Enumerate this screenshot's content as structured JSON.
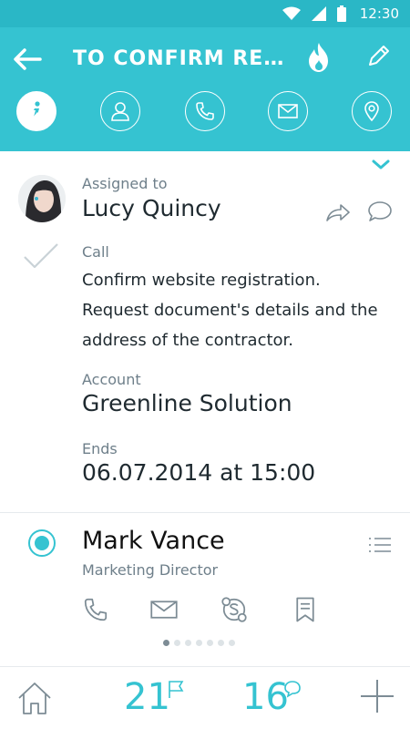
{
  "status": {
    "time": "12:30",
    "icons": [
      "wifi-icon",
      "signal-icon",
      "battery-icon"
    ]
  },
  "header": {
    "title": "TO CONFIRM REGIST...",
    "back_icon": "arrow-left-icon",
    "priority_icon": "fire-icon",
    "edit_icon": "pencil-icon",
    "tabs": [
      {
        "icon": "info-icon",
        "active": true
      },
      {
        "icon": "user-icon",
        "active": false
      },
      {
        "icon": "phone-icon",
        "active": false
      },
      {
        "icon": "mail-icon",
        "active": false
      },
      {
        "icon": "location-icon",
        "active": false
      }
    ]
  },
  "task": {
    "assigned_label": "Assigned to",
    "assigned_name": "Lucy Quincy",
    "type_label": "Call",
    "description": "Confirm website registration. Request document's details and the address of the contractor.",
    "account_label": "Account",
    "account_value": "Greenline Solution",
    "ends_label": "Ends",
    "ends_value": "06.07.2014 at 15:00"
  },
  "contact": {
    "name": "Mark Vance",
    "role": "Marketing Director",
    "actions": [
      "phone-icon",
      "mail-icon",
      "skype-icon",
      "bookmark-icon"
    ],
    "page_count": 7,
    "page_active": 0
  },
  "bottom": {
    "tasks_count": "21",
    "messages_count": "16"
  },
  "colors": {
    "accent": "#35c3d1",
    "status_bar": "#2ab7c6",
    "label": "#6e7f8a"
  }
}
